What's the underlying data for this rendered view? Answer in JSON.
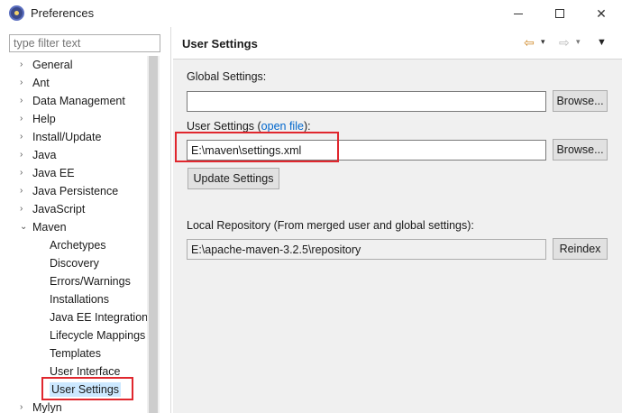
{
  "window": {
    "title": "Preferences",
    "icon": "eclipse-icon",
    "controls": [
      "minimize",
      "maximize",
      "close"
    ]
  },
  "sidebar": {
    "filter_placeholder": "type filter text",
    "items": [
      {
        "label": "General",
        "level": 0,
        "expandable": true
      },
      {
        "label": "Ant",
        "level": 0,
        "expandable": true
      },
      {
        "label": "Data Management",
        "level": 0,
        "expandable": true
      },
      {
        "label": "Help",
        "level": 0,
        "expandable": true
      },
      {
        "label": "Install/Update",
        "level": 0,
        "expandable": true
      },
      {
        "label": "Java",
        "level": 0,
        "expandable": true
      },
      {
        "label": "Java EE",
        "level": 0,
        "expandable": true
      },
      {
        "label": "Java Persistence",
        "level": 0,
        "expandable": true
      },
      {
        "label": "JavaScript",
        "level": 0,
        "expandable": true
      },
      {
        "label": "Maven",
        "level": 0,
        "expandable": true,
        "expanded": true
      },
      {
        "label": "Archetypes",
        "level": 1
      },
      {
        "label": "Discovery",
        "level": 1
      },
      {
        "label": "Errors/Warnings",
        "level": 1
      },
      {
        "label": "Installations",
        "level": 1
      },
      {
        "label": "Java EE Integration",
        "level": 1
      },
      {
        "label": "Lifecycle Mappings",
        "level": 1
      },
      {
        "label": "Templates",
        "level": 1
      },
      {
        "label": "User Interface",
        "level": 1
      },
      {
        "label": "User Settings",
        "level": 1,
        "selected": true
      },
      {
        "label": "Mylyn",
        "level": 0,
        "expandable": true
      }
    ]
  },
  "main": {
    "title": "User Settings",
    "global_settings_label": "Global Settings:",
    "global_settings_value": "",
    "browse_label": "Browse...",
    "user_settings_label_prefix": "User Settings (",
    "user_settings_link": "open file",
    "user_settings_label_suffix": "):",
    "user_settings_value": "E:\\maven\\settings.xml",
    "update_settings_label": "Update Settings",
    "local_repo_label": "Local Repository (From merged user and global settings):",
    "local_repo_value": "E:\\apache-maven-3.2.5\\repository",
    "reindex_label": "Reindex"
  },
  "colors": {
    "highlight": "#e0272e",
    "selection": "#cce8ff",
    "link": "#0066cc"
  }
}
